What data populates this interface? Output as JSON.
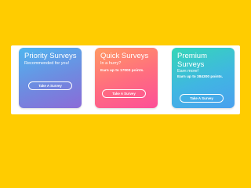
{
  "colors": {
    "background": "#FFCC00",
    "panel": "#FFFFFF",
    "priority_gradient": [
      "#4FB6EF",
      "#8B6BD8"
    ],
    "quick_gradient": [
      "#FF9A63",
      "#FD4F98"
    ],
    "premium_gradient": [
      "#35D7B7",
      "#4AA0EF"
    ]
  },
  "cards": [
    {
      "title": "Priority Surveys",
      "subtitle": "Recommended for you!",
      "description": "",
      "button_label": "Take A Survey"
    },
    {
      "title": "Quick Surveys",
      "subtitle": "In a hurry?",
      "description": "Earn up to 17000 points.",
      "button_label": "Take A Survey"
    },
    {
      "title": "Premium Surveys",
      "subtitle": "Earn more!",
      "description": "Earn up to 384300 points.",
      "button_label": "Take A Survey"
    }
  ]
}
